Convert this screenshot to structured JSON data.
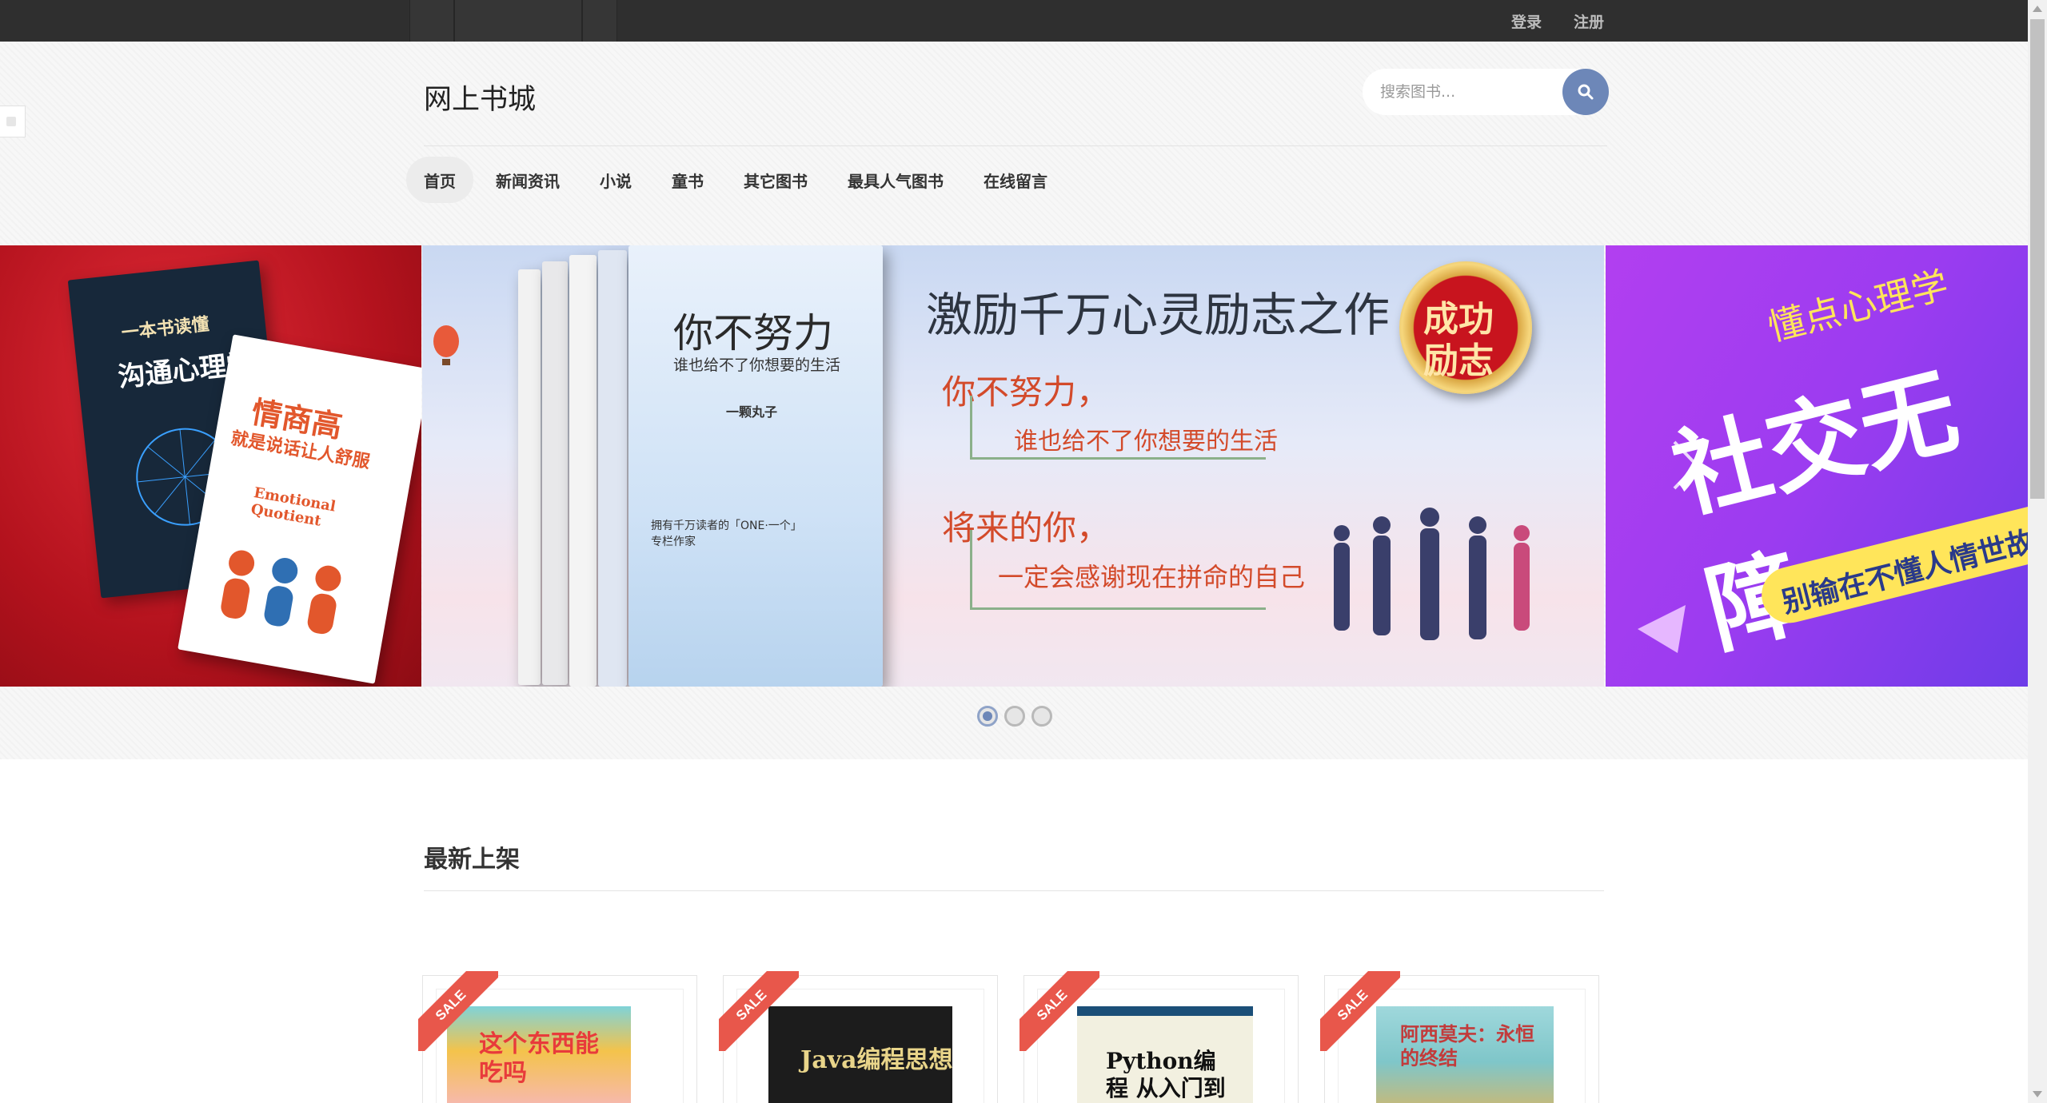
{
  "topbar": {
    "login_label": "登录",
    "register_label": "注册"
  },
  "header": {
    "site_title": "网上书城",
    "search_placeholder": "搜索图书..."
  },
  "nav": {
    "items": [
      {
        "label": "首页",
        "active": true
      },
      {
        "label": "新闻资讯",
        "active": false
      },
      {
        "label": "小说",
        "active": false
      },
      {
        "label": "童书",
        "active": false
      },
      {
        "label": "其它图书",
        "active": false
      },
      {
        "label": "最具人气图书",
        "active": false
      },
      {
        "label": "在线留言",
        "active": false
      }
    ]
  },
  "carousel": {
    "left_slide": {
      "book1_title": "一本书读懂",
      "book1_subtitle": "沟通心理学",
      "book2_title": "情商高",
      "book2_subtitle": "就是说话让人舒服",
      "book2_en": "Emotional Quotient"
    },
    "main_slide": {
      "headline": "激励千万心灵励志之作",
      "badge_line1": "成功",
      "badge_line2": "励志",
      "book_title": "你不努力",
      "book_subtitle": "谁也给不了你想要的生活",
      "author": "一颗丸子",
      "tagline1": "拥有千万读者的「ONE·一个」专栏作家",
      "quote1_a": "你不努力，",
      "quote1_b": "谁也给不了你想要的生活",
      "quote2_a": "将来的你，",
      "quote2_b": "一定会感谢现在拼命的自己"
    },
    "right_slide": {
      "line1": "懂点心理学",
      "line2": "社交无障",
      "line3": "别输在不懂人情世故"
    },
    "dots_count": 3,
    "active_dot": 0
  },
  "latest": {
    "title": "最新上架",
    "products": [
      {
        "sale_label": "SALE",
        "cover_title": "这个东西能吃吗",
        "cover_color": "#f4c34b"
      },
      {
        "sale_label": "SALE",
        "cover_title": "Java编程思想",
        "cover_color": "#1c1c1c"
      },
      {
        "sale_label": "SALE",
        "cover_title": "Python编程 从入门到实践",
        "cover_color": "#f2f0e0"
      },
      {
        "sale_label": "SALE",
        "cover_title": "阿西莫夫：永恒的终结",
        "cover_color": "#7fc6c9"
      }
    ]
  }
}
